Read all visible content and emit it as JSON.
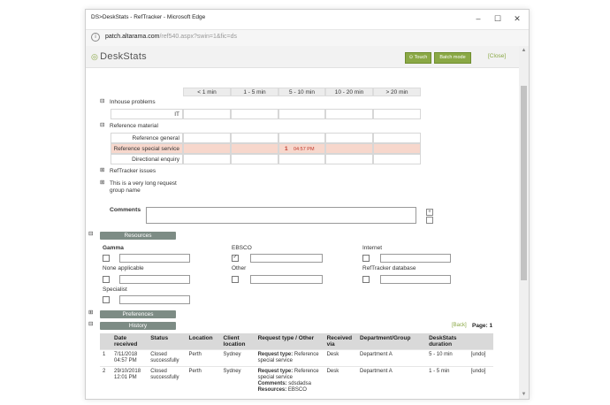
{
  "window": {
    "title": "DS>DeskStats - RefTracker - Microsoft Edge",
    "minimize": "–",
    "maximize": "☐",
    "close": "✕"
  },
  "address": {
    "host": "patch.altarama.com",
    "path": "/ref540.aspx?swin=1&fic=ds"
  },
  "header": {
    "logo": "DeskStats",
    "touch": "Touch",
    "batch": "Batch mode",
    "close": "[Close]"
  },
  "duration_columns": [
    "< 1 min",
    "1 - 5 min",
    "5 - 10 min",
    "10 - 20 min",
    "> 20 min"
  ],
  "groups": {
    "inhouse": {
      "toggle": "⊟",
      "label": "Inhouse problems",
      "rows": [
        "IT"
      ]
    },
    "reference": {
      "toggle": "⊟",
      "label": "Reference material",
      "rows": [
        "Reference general",
        "Reference special service",
        "Directional enquiry"
      ],
      "entry": {
        "count": "1",
        "time": "04:57 PM"
      }
    },
    "reftracker": {
      "toggle": "⊞",
      "label": "RefTracker issues"
    },
    "long": {
      "toggle": "⊞",
      "label_line1": "This is a very long request",
      "label_line2": "group name"
    }
  },
  "comments": {
    "label": "Comments",
    "plus": "+"
  },
  "resources": {
    "toggle": "⊟",
    "title": "Resources",
    "gamma": "Gamma",
    "ebsco": "EBSCO",
    "ebsco_checked": "✓",
    "internet": "Internet",
    "none": "None applicable",
    "other": "Other",
    "reftracker_db": "RefTracker database",
    "specialist": "Specialist"
  },
  "preferences": {
    "toggle": "⊞",
    "title": "Preferences"
  },
  "history": {
    "toggle": "⊟",
    "title": "History",
    "back": "[Back]",
    "page": "Page: 1",
    "columns": [
      "",
      "Date received",
      "Status",
      "Location",
      "Client location",
      "Request type / Other",
      "Received via",
      "Department/Group",
      "DeskStats duration",
      ""
    ],
    "rows": [
      {
        "n": "1",
        "date": "7/11/2018 04:57 PM",
        "status": "Closed successfully",
        "loc": "Perth",
        "client": "Sydney",
        "req_label": "Request type:",
        "req": "Reference special service",
        "comments_label": "",
        "comments": "",
        "res_label": "",
        "res": "",
        "via": "Desk",
        "dept": "Department A",
        "dur": "5 - 10 min",
        "undo": "[undo]"
      },
      {
        "n": "2",
        "date": "29/10/2018 12:01 PM",
        "status": "Closed successfully",
        "loc": "Perth",
        "client": "Sydney",
        "req_label": "Request type:",
        "req": "Reference special service",
        "comments_label": "Comments:",
        "comments": "sdsdadsa",
        "res_label": "Resources:",
        "res": "EBSCO",
        "via": "Desk",
        "dept": "Department A",
        "dur": "1 - 5 min",
        "undo": "[undo]"
      }
    ]
  },
  "colors": {
    "accent": "#8aa845",
    "section_bar": "#7d8c85",
    "highlight": "#f7d7cc"
  }
}
